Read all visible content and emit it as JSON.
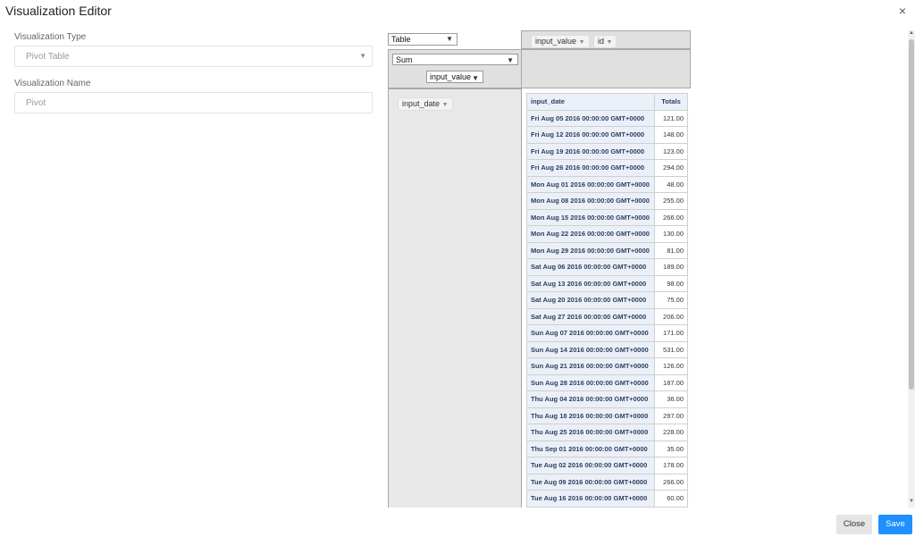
{
  "dialog": {
    "title": "Visualization Editor",
    "close_glyph": "×"
  },
  "form": {
    "type_label": "Visualization Type",
    "type_value": "Pivot Table",
    "name_label": "Visualization Name",
    "name_value": "Pivot"
  },
  "pivot": {
    "renderer": "Table",
    "aggregator": "Sum",
    "aggregator_value_field": "input_value",
    "column_fields": [
      "input_value",
      "id"
    ],
    "row_field": "input_date",
    "table": {
      "row_header": "input_date",
      "totals_header": "Totals",
      "rows": [
        {
          "label": "Fri Aug 05 2016 00:00:00 GMT+0000",
          "value": "121.00"
        },
        {
          "label": "Fri Aug 12 2016 00:00:00 GMT+0000",
          "value": "148.00"
        },
        {
          "label": "Fri Aug 19 2016 00:00:00 GMT+0000",
          "value": "123.00"
        },
        {
          "label": "Fri Aug 26 2016 00:00:00 GMT+0000",
          "value": "294.00"
        },
        {
          "label": "Mon Aug 01 2016 00:00:00 GMT+0000",
          "value": "48.00"
        },
        {
          "label": "Mon Aug 08 2016 00:00:00 GMT+0000",
          "value": "255.00"
        },
        {
          "label": "Mon Aug 15 2016 00:00:00 GMT+0000",
          "value": "266.00"
        },
        {
          "label": "Mon Aug 22 2016 00:00:00 GMT+0000",
          "value": "130.00"
        },
        {
          "label": "Mon Aug 29 2016 00:00:00 GMT+0000",
          "value": "81.00"
        },
        {
          "label": "Sat Aug 06 2016 00:00:00 GMT+0000",
          "value": "189.00"
        },
        {
          "label": "Sat Aug 13 2016 00:00:00 GMT+0000",
          "value": "98.00"
        },
        {
          "label": "Sat Aug 20 2016 00:00:00 GMT+0000",
          "value": "75.00"
        },
        {
          "label": "Sat Aug 27 2016 00:00:00 GMT+0000",
          "value": "206.00"
        },
        {
          "label": "Sun Aug 07 2016 00:00:00 GMT+0000",
          "value": "171.00"
        },
        {
          "label": "Sun Aug 14 2016 00:00:00 GMT+0000",
          "value": "531.00"
        },
        {
          "label": "Sun Aug 21 2016 00:00:00 GMT+0000",
          "value": "126.00"
        },
        {
          "label": "Sun Aug 28 2016 00:00:00 GMT+0000",
          "value": "187.00"
        },
        {
          "label": "Thu Aug 04 2016 00:00:00 GMT+0000",
          "value": "36.00"
        },
        {
          "label": "Thu Aug 18 2016 00:00:00 GMT+0000",
          "value": "297.00"
        },
        {
          "label": "Thu Aug 25 2016 00:00:00 GMT+0000",
          "value": "228.00"
        },
        {
          "label": "Thu Sep 01 2016 00:00:00 GMT+0000",
          "value": "35.00"
        },
        {
          "label": "Tue Aug 02 2016 00:00:00 GMT+0000",
          "value": "178.00"
        },
        {
          "label": "Tue Aug 09 2016 00:00:00 GMT+0000",
          "value": "266.00"
        },
        {
          "label": "Tue Aug 16 2016 00:00:00 GMT+0000",
          "value": "60.00"
        }
      ]
    }
  },
  "footer": {
    "close_label": "Close",
    "save_label": "Save"
  },
  "colors": {
    "save_button": "#1e90ff",
    "table_header": "#ebf0f8",
    "drop_area": "#e0e0e0"
  }
}
